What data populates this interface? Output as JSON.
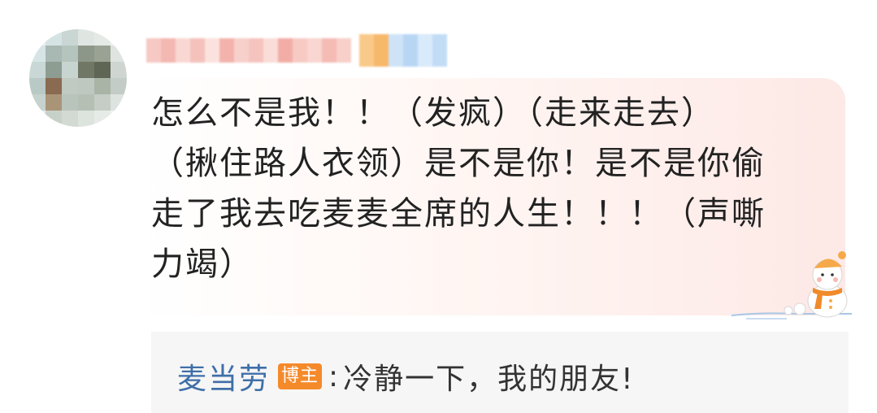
{
  "comment": {
    "user": {
      "avatar_icon": "avatar-pixelated",
      "username_hidden": true
    },
    "text": "怎么不是我！！（发疯）（走来走去）\n（揪住路人衣领）是不是你！是不是你偷\n走了我去吃麦麦全席的人生！！！（声嘶\n力竭）",
    "decoration_icon": "snowman-icon"
  },
  "reply": {
    "author": "麦当劳",
    "tag": "博主",
    "separator": ":",
    "text": "冷静一下，我的朋友!"
  },
  "colors": {
    "reply_author": "#3f6fa8",
    "tag_bg": "#f58a2b",
    "reply_bg": "#f6f6f6"
  }
}
